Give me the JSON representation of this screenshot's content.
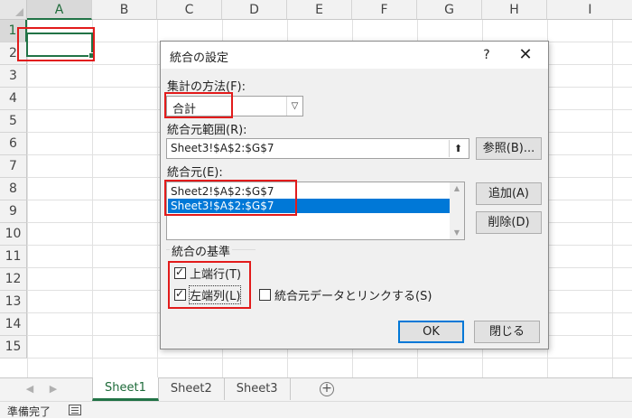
{
  "spreadsheet": {
    "columns": [
      "A",
      "B",
      "C",
      "D",
      "E",
      "F",
      "G",
      "H",
      "I"
    ],
    "rows": [
      "1",
      "2",
      "3",
      "4",
      "5",
      "6",
      "7",
      "8",
      "9",
      "10",
      "11",
      "12",
      "13",
      "14",
      "15"
    ],
    "active_cell": "A1"
  },
  "tabs": {
    "sheets": [
      "Sheet1",
      "Sheet2",
      "Sheet3"
    ],
    "active_sheet": "Sheet1",
    "add_sheet_symbol": "+"
  },
  "status_bar": {
    "text": "準備完了"
  },
  "dialog": {
    "title": "統合の設定",
    "help_label": "?",
    "close_label": "✕",
    "function_label": "集計の方法(F):",
    "function_value": "合計",
    "reference_label": "統合元範囲(R):",
    "reference_value": "Sheet3!$A$2:$G$7",
    "browse_button": "参照(B)...",
    "all_references_label": "統合元(E):",
    "all_references": [
      "Sheet2!$A$2:$G$7",
      "Sheet3!$A$2:$G$7"
    ],
    "selected_reference_index": 1,
    "add_button": "追加(A)",
    "delete_button": "削除(D)",
    "use_labels_group": "統合の基準",
    "top_row_label": "上端行(T)",
    "top_row_checked": true,
    "left_column_label": "左端列(L)",
    "left_column_checked": true,
    "create_links_label": "統合元データとリンクする(S)",
    "create_links_checked": false,
    "ok_button": "OK",
    "close_button": "閉じる"
  },
  "colors": {
    "excel_green": "#217346",
    "selection_blue": "#0078d7",
    "highlight_red": "#e21b1b"
  }
}
